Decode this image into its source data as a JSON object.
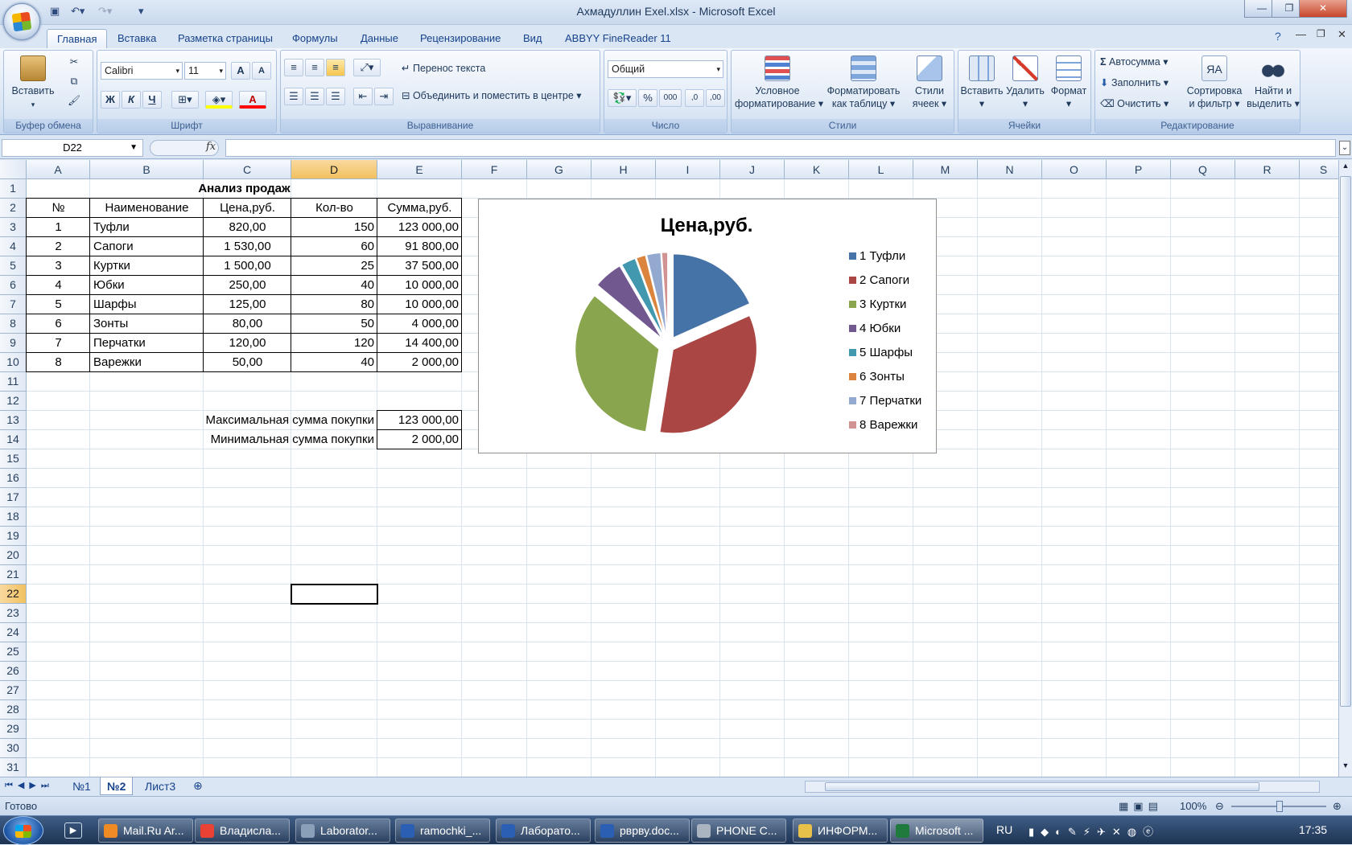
{
  "window": {
    "title": "Ахмадуллин Exel.xlsx - Microsoft Excel",
    "min": "—",
    "max": "❐",
    "close": "✕"
  },
  "ribbon_tabs": [
    "Главная",
    "Вставка",
    "Разметка страницы",
    "Формулы",
    "Данные",
    "Рецензирование",
    "Вид",
    "ABBYY FineReader 11"
  ],
  "ribbon": {
    "clipboard": {
      "label": "Буфер обмена",
      "paste": "Вставить"
    },
    "font": {
      "label": "Шрифт",
      "name": "Calibri",
      "size": "11",
      "bold": "Ж",
      "italic": "К",
      "underline": "Ч",
      "grow": "A",
      "shrink": "A",
      "fontcolor": "A"
    },
    "alignment": {
      "label": "Выравнивание",
      "wrap": "Перенос текста",
      "merge": "Объединить и поместить в центре"
    },
    "number": {
      "label": "Число",
      "format": "Общий",
      "percent": "%",
      "thousands": "000",
      "inc": ",0",
      "dec": ",00"
    },
    "styles": {
      "label": "Стили",
      "conditional_1": "Условное",
      "conditional_2": "форматирование",
      "astable_1": "Форматировать",
      "astable_2": "как таблицу",
      "cellstyles_1": "Стили",
      "cellstyles_2": "ячеек"
    },
    "cells": {
      "label": "Ячейки",
      "insert": "Вставить",
      "delete": "Удалить",
      "format": "Формат"
    },
    "editing": {
      "label": "Редактирование",
      "autosum": "Автосумма",
      "fill": "Заполнить",
      "clear": "Очистить",
      "sort_1": "Сортировка",
      "sort_2": "и фильтр",
      "find_1": "Найти и",
      "find_2": "выделить"
    }
  },
  "formula_bar": {
    "name_box": "D22",
    "fx": "fx",
    "formula": ""
  },
  "columns": [
    "A",
    "B",
    "C",
    "D",
    "E",
    "F",
    "G",
    "H",
    "I",
    "J",
    "K",
    "L",
    "M",
    "N",
    "O",
    "P",
    "Q",
    "R",
    "S"
  ],
  "rows": [
    "1",
    "2",
    "3",
    "4",
    "5",
    "6",
    "7",
    "8",
    "9",
    "10",
    "11",
    "12",
    "13",
    "14",
    "15",
    "16",
    "17",
    "18",
    "19",
    "20",
    "21",
    "22",
    "23",
    "24",
    "25",
    "26",
    "27",
    "28",
    "29",
    "30",
    "31"
  ],
  "table": {
    "title": "Анализ продаж",
    "headers": [
      "№",
      "Наименование",
      "Цена,руб.",
      "Кол-во",
      "Сумма,руб."
    ],
    "rows": [
      [
        "1",
        "Туфли",
        "820,00",
        "150",
        "123 000,00"
      ],
      [
        "2",
        "Сапоги",
        "1 530,00",
        "60",
        "91 800,00"
      ],
      [
        "3",
        "Куртки",
        "1 500,00",
        "25",
        "37 500,00"
      ],
      [
        "4",
        "Юбки",
        "250,00",
        "40",
        "10 000,00"
      ],
      [
        "5",
        "Шарфы",
        "125,00",
        "80",
        "10 000,00"
      ],
      [
        "6",
        "Зонты",
        "80,00",
        "50",
        "4 000,00"
      ],
      [
        "7",
        "Перчатки",
        "120,00",
        "120",
        "14 400,00"
      ],
      [
        "8",
        "Варежки",
        "50,00",
        "40",
        "2 000,00"
      ]
    ],
    "max_label": "Максимальная сумма покупки",
    "max_value": "123 000,00",
    "min_label": "Минимальная сумма покупки",
    "min_value": "2 000,00"
  },
  "chart_data": {
    "type": "pie",
    "title": "Цена,руб.",
    "categories": [
      "1 Туфли",
      "2 Сапоги",
      "3 Куртки",
      "4 Юбки",
      "5 Шарфы",
      "6 Зонты",
      "7 Перчатки",
      "8 Варежки"
    ],
    "values": [
      820,
      1530,
      1500,
      250,
      125,
      80,
      120,
      50
    ],
    "colors": [
      "#4572a7",
      "#aa4643",
      "#89a54e",
      "#71588f",
      "#4198af",
      "#db843d",
      "#93a9cf",
      "#d19392"
    ],
    "legend": "right",
    "exploded": true
  },
  "sheet_tabs": [
    "№1",
    "№2",
    "Лист3"
  ],
  "active_sheet": "№2",
  "status": {
    "ready": "Готово",
    "zoom": "100%"
  },
  "taskbar": {
    "items": [
      "Mail.Ru Ar...",
      "Владисла...",
      "Laborator...",
      "ramochki_...",
      "Лаборато...",
      "рврву.doc...",
      "PHONE C...",
      "ИНФОРМ...",
      "Microsoft ..."
    ],
    "lang": "RU",
    "clock": "17:35"
  }
}
